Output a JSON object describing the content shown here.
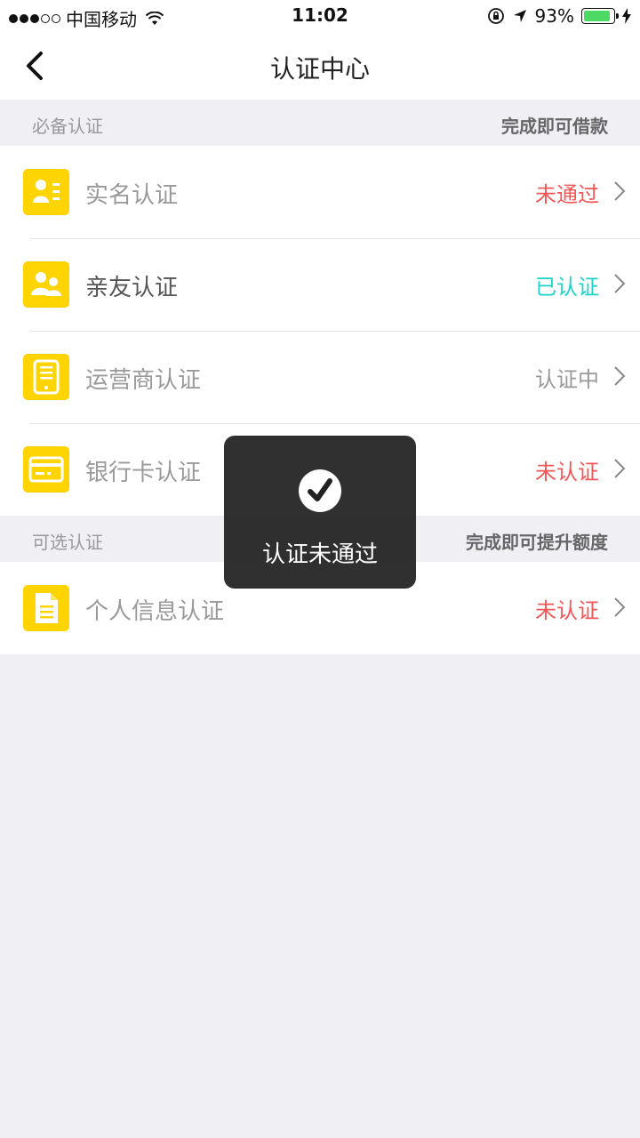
{
  "status_bar": {
    "carrier": "中国移动",
    "time": "11:02",
    "battery": "93%",
    "battery_level": 0.93
  },
  "nav": {
    "title": "认证中心",
    "back_icon": "chevron-left-icon"
  },
  "required_section": {
    "title": "必备认证",
    "note": "完成即可借款",
    "items": [
      {
        "label": "实名认证",
        "status": "未通过",
        "icon": "id-card-icon",
        "status_color": "#f35658"
      },
      {
        "label": "亲友认证",
        "status": "已认证",
        "icon": "contacts-icon",
        "status_color": "#1cd3c6"
      },
      {
        "label": "运营商认证",
        "status": "认证中",
        "icon": "phone-icon",
        "status_color": "#999999"
      },
      {
        "label": "银行卡认证",
        "status": "未认证",
        "icon": "bank-card-icon",
        "status_color": "#f35658"
      }
    ]
  },
  "optional_section": {
    "title": "可选认证",
    "note": "完成即可提升额度",
    "items": [
      {
        "label": "个人信息认证",
        "status": "未认证",
        "icon": "document-icon",
        "status_color": "#f35658"
      }
    ]
  },
  "toast": {
    "text": "认证未通过",
    "icon": "check-circle-icon"
  },
  "colors": {
    "accent": "#ffd400",
    "background": "#efeff4"
  }
}
